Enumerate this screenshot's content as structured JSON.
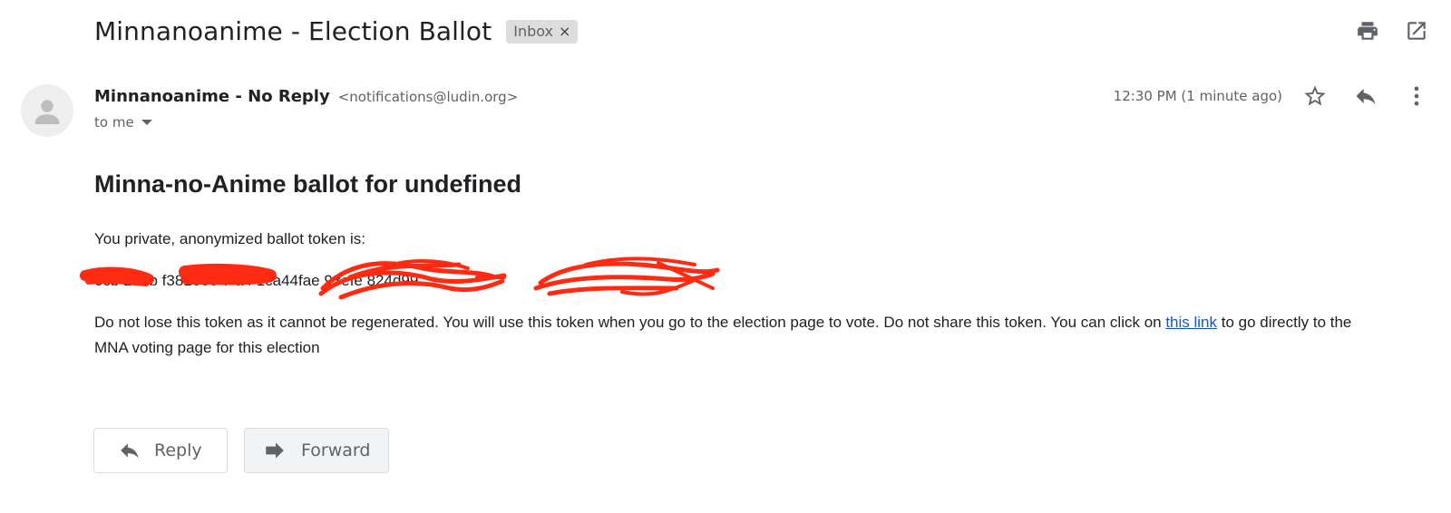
{
  "email": {
    "subject": "Minnanoanime - Election Ballot",
    "label": "Inbox",
    "label_close": "×",
    "sender_name": "Minnanoanime - No Reply",
    "sender_email": "<notifications@ludin.org>",
    "recipient": "to me",
    "timestamp": "12:30 PM (1 minute ago)"
  },
  "icons": {
    "top_actions": [
      "print-icon",
      "open-in-new-window-icon"
    ],
    "message_actions": [
      "star-icon",
      "reply-icon",
      "more-vert-icon"
    ],
    "avatar": "person-icon"
  },
  "body": {
    "heading": "Minna-no-Anime ballot for undefined",
    "intro": "You private, anonymized ballot token is:",
    "token_visible": "0cb  270b        f381666       7 a4 1ca44fae 93efe        824d99",
    "warning_before": "Do not lose this token as it cannot be regenerated. You will use this token when you go to the election page to vote. Do not share this token. You can click on ",
    "link_text": "this link",
    "warning_after": " to go directly to the MNA voting page for this election"
  },
  "buttons": {
    "reply": "Reply",
    "forward": "Forward"
  },
  "colors": {
    "link": "#1155cc",
    "redaction": "#ff2a12",
    "label_chip": "#dddddd",
    "secondary_text": "#5f6368"
  }
}
